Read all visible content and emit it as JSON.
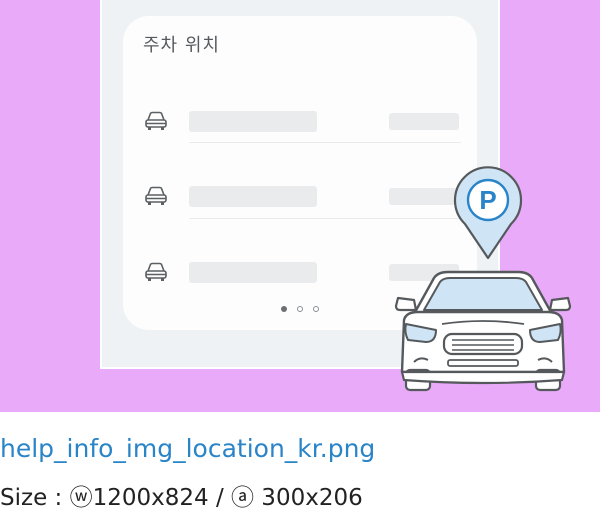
{
  "card": {
    "title": "주차 위치",
    "rows": [
      {
        "icon": "car-icon"
      },
      {
        "icon": "car-icon"
      },
      {
        "icon": "car-icon"
      }
    ],
    "pagination": {
      "count": 3,
      "active": 1
    }
  },
  "badge": {
    "letter": "P"
  },
  "caption": {
    "filename": "help_info_img_location_kr.png",
    "size": "Size : ⓦ1200x824 / ⓐ 300x206"
  },
  "colors": {
    "background": "#e9abf9",
    "phone": "#eef2f4",
    "card": "#fdfdfd",
    "pin_fill": "#cfe4f5",
    "accent": "#2a84c8",
    "link": "#2a84c8"
  }
}
